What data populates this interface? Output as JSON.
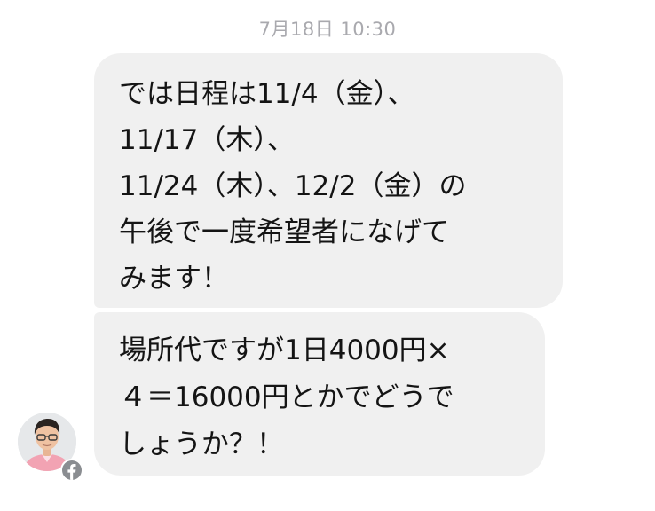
{
  "thread": {
    "timestamp": "7月18日 10:30",
    "messages": [
      {
        "text": "では日程は11/4（金）、\n11/17（木）、\n11/24（木）、12/2（金）の\n午後で一度希望者になげて\nみます！"
      },
      {
        "text": "場所代ですが1日4000円×\n４＝16000円とかでどうで\nしょうか？！"
      }
    ]
  },
  "sender": {
    "avatar_icon": "person-avatar",
    "badge_icon": "facebook-icon",
    "badge_color": "#8a8d91"
  },
  "colors": {
    "bubble_background": "#f0f0f0",
    "timestamp_text": "#a9a9ae",
    "message_text": "#141414"
  }
}
